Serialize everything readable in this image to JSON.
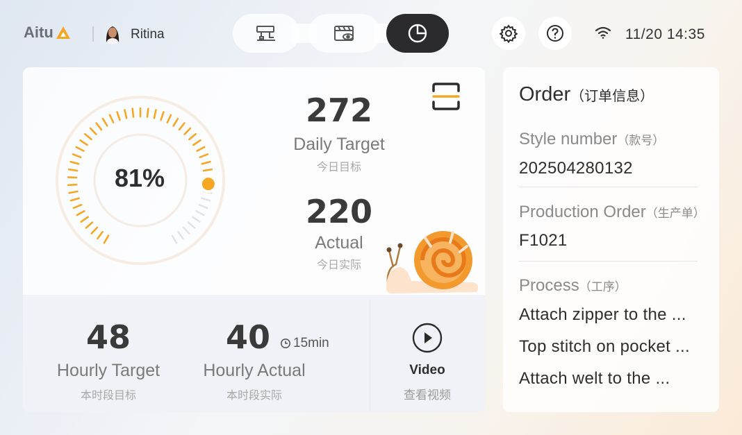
{
  "header": {
    "logo_text": "Aitu",
    "user_name": "Ritina",
    "nav_tabs": [
      {
        "icon": "machine-icon",
        "active": false
      },
      {
        "icon": "video-board-icon",
        "active": false
      },
      {
        "icon": "pie-chart-icon",
        "active": true
      }
    ],
    "settings_icon": "gear-icon",
    "help_icon": "help-icon",
    "wifi_icon": "wifi-icon",
    "datetime": "11/20 14:35"
  },
  "progress": {
    "percent_label": "81%",
    "value": 0.81,
    "accent_color": "#F5A623"
  },
  "daily": {
    "target_value": "272",
    "target_label": "Daily Target",
    "target_label_cn": "今日目标",
    "actual_value": "220",
    "actual_label": "Actual",
    "actual_label_cn": "今日实际"
  },
  "hourly": {
    "target_value": "48",
    "target_label": "Hourly Target",
    "target_label_cn": "本时段目标",
    "actual_value": "40",
    "interval": "15min",
    "actual_label": "Hourly Actual",
    "actual_label_cn": "本时段实际"
  },
  "video": {
    "label": "Video",
    "label_cn": "查看视频"
  },
  "order": {
    "title": "Order",
    "title_cn": "（订单信息）",
    "style_label": "Style number",
    "style_label_cn": "（款号）",
    "style_value": "202504280132",
    "production_label": "Production Order",
    "production_label_cn": "（生产单）",
    "production_value": "F1021",
    "process_label": "Process",
    "process_label_cn": "（工序）",
    "processes": [
      "Attach zipper to the ...",
      "Top stitch on pocket ...",
      "Attach welt to the ..."
    ]
  }
}
